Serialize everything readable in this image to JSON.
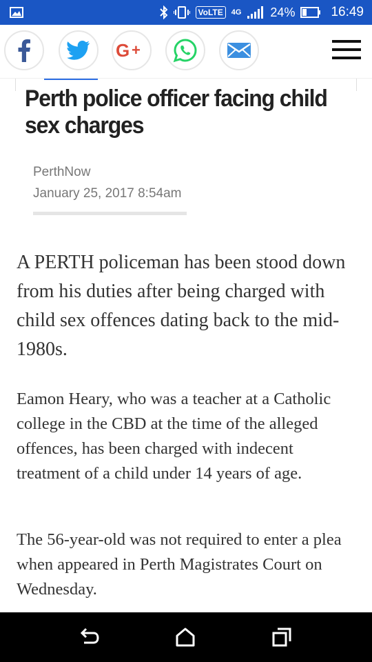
{
  "status_bar": {
    "volte": "VoLTE",
    "network": "4G",
    "battery_percent": "24%",
    "time": "16:49",
    "background_color": "#1a56c4",
    "icons": [
      "image-icon",
      "bluetooth-icon",
      "vibrate-icon",
      "signal-icon",
      "battery-icon"
    ]
  },
  "share_bar": {
    "buttons": [
      {
        "name": "facebook",
        "icon": "facebook-icon",
        "color": "#3b5998"
      },
      {
        "name": "twitter",
        "icon": "twitter-icon",
        "color": "#1da1f2"
      },
      {
        "name": "google-plus",
        "icon": "google-plus-icon",
        "color": "#dd4b39"
      },
      {
        "name": "whatsapp",
        "icon": "whatsapp-icon",
        "color": "#25d366"
      },
      {
        "name": "email",
        "icon": "email-icon",
        "color": "#3b8fe0"
      }
    ],
    "menu_icon": "hamburger-menu-icon"
  },
  "article": {
    "headline": "Perth police officer facing child sex charges",
    "source": "PerthNow",
    "date": "January 25, 2017 8:54am",
    "lead": "A PERTH policeman has been stood down from his duties after being charged with child sex offences dating back to the mid-1980s.",
    "paragraphs": [
      "Eamon Heary, who was a teacher at a Catholic college in the CBD at the time of the alleged offences, has been charged with indecent treatment of a child under 14 years of age.",
      "The 56-year-old was not required to enter a plea when appeared in Perth Magistrates Court on Wednesday."
    ]
  },
  "nav_bar": {
    "buttons": [
      "back-icon",
      "home-icon",
      "recents-icon"
    ]
  }
}
